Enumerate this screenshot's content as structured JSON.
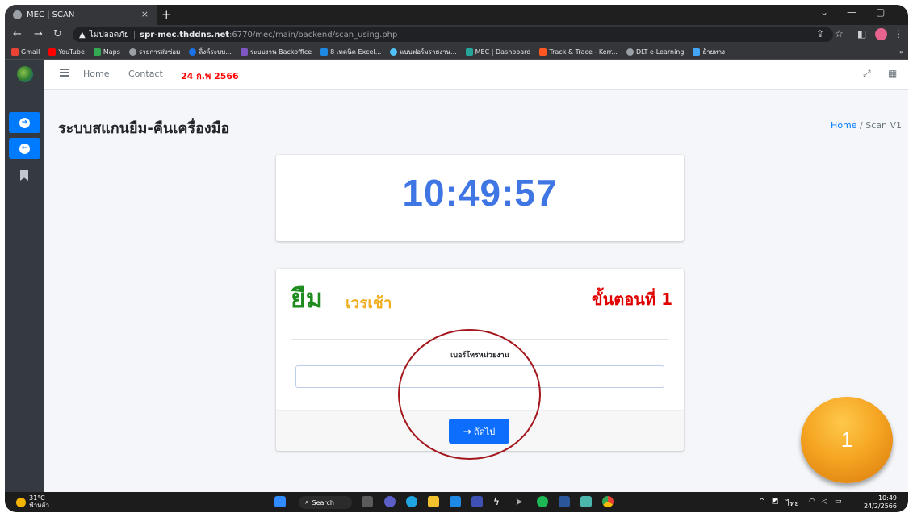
{
  "browser": {
    "tab_title": "MEC | SCAN",
    "tab_close": "×",
    "new_tab": "+",
    "security_label": "ไม่ปลอดภัย",
    "url_host": "spr-mec.thddns.net",
    "url_path": ":6770/mec/main/backend/scan_using.php",
    "bookmarks": [
      {
        "label": "Gmail",
        "color": "#ea4335"
      },
      {
        "label": "YouTube",
        "color": "#ff0000"
      },
      {
        "label": "Maps",
        "color": "#34a853"
      },
      {
        "label": "รายการส่งซ่อม",
        "color": "#9aa0a6"
      },
      {
        "label": "ลิ้งค์ระบบ...",
        "color": "#1a73e8"
      },
      {
        "label": "ระบบงาน Backoffice",
        "color": "#7e57c2"
      },
      {
        "label": "8 เทคนิค Excel...",
        "color": "#1e88e5"
      },
      {
        "label": "แบบฟอร์มรายงาน...",
        "color": "#4fc3f7"
      },
      {
        "label": "MEC | Dashboard",
        "color": "#26a69a"
      },
      {
        "label": "Track & Trace - Kerr...",
        "color": "#ff5722"
      },
      {
        "label": "DLT e-Learning",
        "color": "#9aa0a6"
      },
      {
        "label": "ย้ายทาง",
        "color": "#42a5f5"
      }
    ],
    "bookmarks_overflow": "»"
  },
  "navbar": {
    "home": "Home",
    "contact": "Contact",
    "date": "24 ก.พ 2566"
  },
  "page": {
    "title": "ระบบสแกนยืม-คืนเครื่องมือ",
    "breadcrumb_home": "Home",
    "breadcrumb_sep": " / ",
    "breadcrumb_current": "Scan V1"
  },
  "clock": {
    "time": "10:49:57"
  },
  "form": {
    "action": "ยืม",
    "shift": "เวรเช้า",
    "step": "ขั้นตอนที่ 1",
    "field_label": "เบอร์โทรหน่วยงาน",
    "field_value": "",
    "next_arrow": "→",
    "next_label": "ถัดไป"
  },
  "annotation": {
    "badge_number": "1"
  },
  "taskbar": {
    "temperature": "31°C",
    "weather": "ฟ้าหลัว",
    "search": "Search",
    "lang": "ไทย",
    "time": "10:49",
    "date": "24/2/2566"
  }
}
